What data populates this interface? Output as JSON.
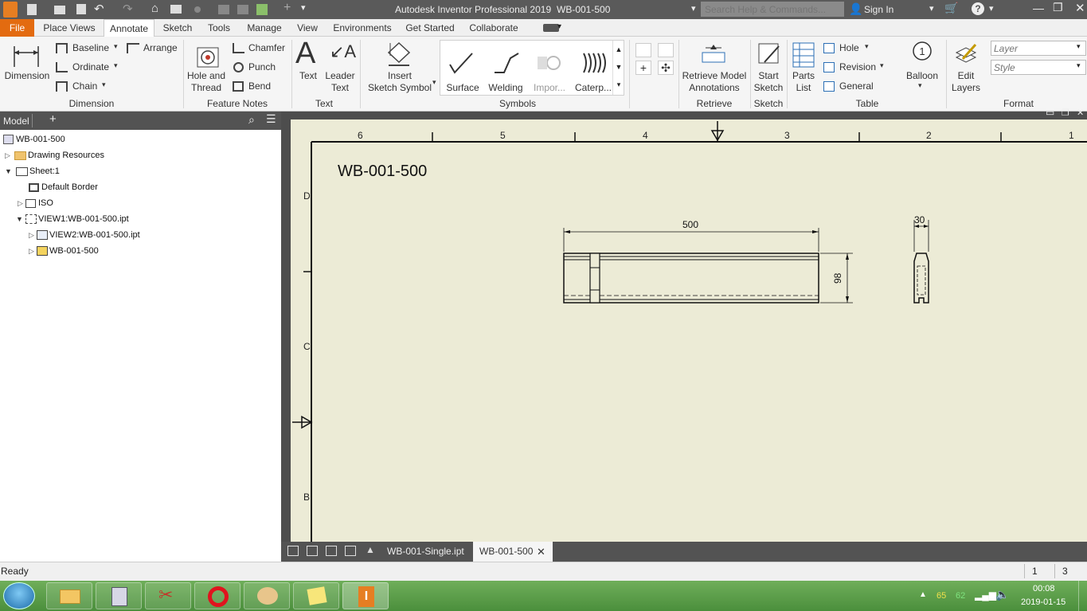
{
  "window": {
    "title": "Autodesk Inventor Professional 2019",
    "document": "WB-001-500",
    "search_placeholder": "Search Help & Commands...",
    "sign_in": "Sign In"
  },
  "ribbon_tabs": [
    "File",
    "Place Views",
    "Annotate",
    "Sketch",
    "Tools",
    "Manage",
    "View",
    "Environments",
    "Get Started",
    "Collaborate"
  ],
  "active_tab": "Annotate",
  "ribbon": {
    "dimension": {
      "main": "Dimension",
      "baseline": "Baseline",
      "ordinate": "Ordinate",
      "chain": "Chain",
      "arrange": "Arrange",
      "panel": "Dimension"
    },
    "feature_notes": {
      "hole_thread": [
        "Hole and",
        "Thread"
      ],
      "chamfer": "Chamfer",
      "punch": "Punch",
      "bend": "Bend",
      "panel": "Feature Notes"
    },
    "text": {
      "text": "Text",
      "leader_text": [
        "Leader",
        "Text"
      ],
      "panel": "Text"
    },
    "symbols": {
      "insert": [
        "Insert",
        "Sketch Symbol"
      ],
      "surface": "Surface",
      "welding": "Welding",
      "import": "Impor...",
      "caterpillar": "Caterp...",
      "panel": "Symbols"
    },
    "retrieve": {
      "btn": [
        "Retrieve Model",
        "Annotations"
      ],
      "panel": "Retrieve"
    },
    "sketch": {
      "btn": [
        "Start",
        "Sketch"
      ],
      "panel": "Sketch"
    },
    "table": {
      "parts_list": [
        "Parts",
        "List"
      ],
      "hole": "Hole",
      "revision": "Revision",
      "general": "General",
      "balloon": "Balloon",
      "panel": "Table"
    },
    "format": {
      "edit_layers": [
        "Edit",
        "Layers"
      ],
      "layer_placeholder": "Layer",
      "style_placeholder": "Style",
      "panel": "Format"
    }
  },
  "browser": {
    "title": "Model",
    "tree": [
      {
        "label": "WB-001-500",
        "depth": 0
      },
      {
        "label": "Drawing Resources",
        "depth": 1
      },
      {
        "label": "Sheet:1",
        "depth": 1
      },
      {
        "label": "Default Border",
        "depth": 2
      },
      {
        "label": "ISO",
        "depth": 2
      },
      {
        "label": "VIEW1:WB-001-500.ipt",
        "depth": 2
      },
      {
        "label": "VIEW2:WB-001-500.ipt",
        "depth": 3
      },
      {
        "label": "WB-001-500",
        "depth": 3
      }
    ]
  },
  "drawing": {
    "title": "WB-001-500",
    "col_labels": [
      "6",
      "5",
      "4",
      "3",
      "2",
      "1"
    ],
    "row_labels": [
      "D",
      "C",
      "B"
    ],
    "dim_length": "500",
    "dim_height": "98",
    "dim_width": "30"
  },
  "doc_tabs": [
    "WB-001-Single.ipt",
    "WB-001-500"
  ],
  "active_doc_tab": "WB-001-500",
  "status": {
    "text": "Ready",
    "count1": "1",
    "count2": "3"
  },
  "taskbar": {
    "time": "00:08",
    "date": "2019-01-15",
    "tray_num1": "65",
    "tray_num2": "62"
  }
}
